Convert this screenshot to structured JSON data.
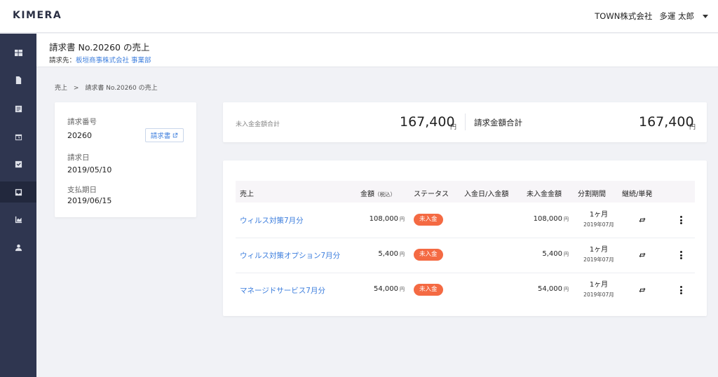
{
  "app": {
    "logo": "KIMERA",
    "company": "TOWN株式会社",
    "user": "多運 太郎"
  },
  "page": {
    "title": "請求書 No.20260 の売上",
    "billing_to_label": "請求先：",
    "billing_to_value": "板垣商事株式会社  事業部"
  },
  "breadcrumb": {
    "root": "売上",
    "sep": ">",
    "current": "請求書 No.20260 の売上"
  },
  "sidebar": {
    "icons": [
      "dashboard-icon",
      "document-icon",
      "list-icon",
      "calendar-icon",
      "checkbox-icon",
      "inbox-icon",
      "chart-icon",
      "user-icon"
    ],
    "active_index": 5
  },
  "invoice": {
    "number_label": "請求番号",
    "number_value": "20260",
    "doc_button": "請求書",
    "date_label": "請求日",
    "date_value": "2019/05/10",
    "due_label": "支払期日",
    "due_value": "2019/06/15"
  },
  "totals": {
    "unpaid_label": "未入金金額合計",
    "unpaid_value": "167,400",
    "billed_label": "請求金額合計",
    "billed_value": "167,400",
    "unit": "円"
  },
  "table": {
    "headers": {
      "sales": "売上",
      "amount": "金額",
      "amount_note": "（税込）",
      "status": "ステータス",
      "payment": "入金日/入金額",
      "unpaid": "未入金金額",
      "period": "分割期間",
      "type": "継続/単発"
    },
    "unit": "円",
    "rows": [
      {
        "name": "ウィルス対策7月分",
        "amount": "108,000",
        "status": "未入金",
        "unpaid": "108,000",
        "period": "1ヶ月",
        "period_month": "2019年07月"
      },
      {
        "name": "ウィルス対策オプション7月分",
        "amount": "5,400",
        "status": "未入金",
        "unpaid": "5,400",
        "period": "1ヶ月",
        "period_month": "2019年07月"
      },
      {
        "name": "マネージドサービス7月分",
        "amount": "54,000",
        "status": "未入金",
        "unpaid": "54,000",
        "period": "1ヶ月",
        "period_month": "2019年07月"
      }
    ]
  },
  "colors": {
    "sidebar": "#2f3650",
    "accent": "#3b7ddd",
    "badge": "#f46a43"
  }
}
